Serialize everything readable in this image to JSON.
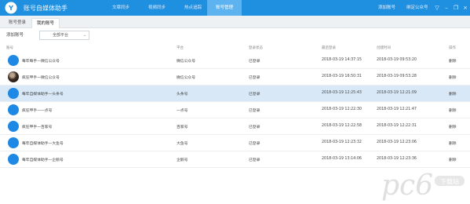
{
  "app": {
    "title": "账号自媒体助手"
  },
  "nav": {
    "items": [
      "文章同步",
      "视频同步",
      "热点追踪",
      "账号管理"
    ],
    "active_index": 3
  },
  "topright": {
    "add_account": "添加账号",
    "bind_wechat": "绑定公众号"
  },
  "subtabs": {
    "items": [
      "账号登录",
      "我的账号"
    ],
    "active_index": 1
  },
  "toolbar": {
    "add_label": "添加账号",
    "platform_select": "全部平台"
  },
  "table": {
    "headers": [
      "账号",
      "平台",
      "登录状态",
      "最后登录",
      "创建时间",
      "操作"
    ],
    "rows": [
      {
        "account": "每年每手—微信公众号",
        "platform": "微信公众号",
        "status": "已登录",
        "last": "2018-03-19 14:37:15",
        "created": "2018-03-19 09:53:20",
        "op": "删除",
        "avatar": "blue"
      },
      {
        "account": "疯狂甲手—微信公众号",
        "platform": "微信公众号",
        "status": "已登录",
        "last": "2018-03-19 16:50:31",
        "created": "2018-03-19 09:53:28",
        "op": "删除",
        "avatar": "photo"
      },
      {
        "account": "每年自媒体助手—头条号",
        "platform": "头条号",
        "status": "已登录",
        "last": "2018-03-19 12:25:43",
        "created": "2018-03-19 12:21:09",
        "op": "删除",
        "avatar": "blue"
      },
      {
        "account": "疯狂甲手—一点号",
        "platform": "一点号",
        "status": "已登录",
        "last": "2018-03-19 12:22:30",
        "created": "2018-03-19 12:21:47",
        "op": "删除",
        "avatar": "blue"
      },
      {
        "account": "疯狂甲手—百家号",
        "platform": "百家号",
        "status": "已登录",
        "last": "2018-03-19 12:22:58",
        "created": "2018-03-19 12:22:31",
        "op": "删除",
        "avatar": "blue"
      },
      {
        "account": "每年自媒体助手—大鱼号",
        "platform": "大鱼号",
        "status": "已登录",
        "last": "2018-03-19 12:23:32",
        "created": "2018-03-19 12:23:06",
        "op": "删除",
        "avatar": "blue"
      },
      {
        "account": "每年自媒体助手—企鹅号",
        "platform": "企鹅号",
        "status": "已登录",
        "last": "2018-03-19 13:14:06",
        "created": "2018-03-19 12:23:36",
        "op": "删除",
        "avatar": "blue"
      }
    ],
    "selected_index": 2
  },
  "watermark": {
    "text": "pc6",
    "sub": "下载站"
  },
  "colors": {
    "topbar": "#1f8fe0",
    "active_tab": "#5db3f0",
    "selected_row": "#d8e8f7",
    "avatar": "#1e88e5"
  }
}
